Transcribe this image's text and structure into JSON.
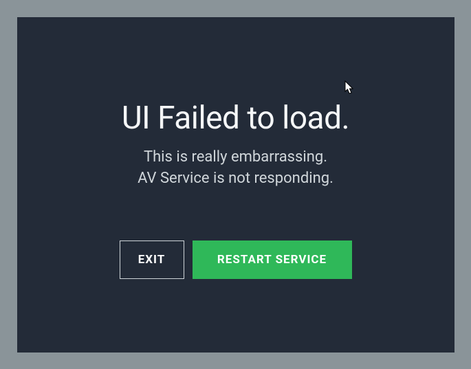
{
  "dialog": {
    "title": "UI Failed to load.",
    "subtitle_line1": "This is really embarrassing.",
    "subtitle_line2": "AV Service is not responding.",
    "buttons": {
      "exit": "EXIT",
      "restart": "RESTART SERVICE"
    }
  }
}
